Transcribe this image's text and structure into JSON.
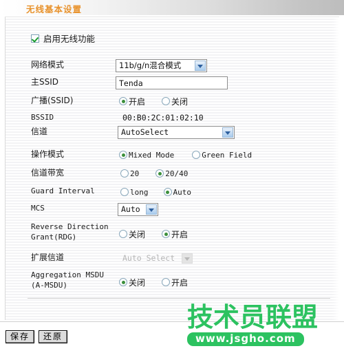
{
  "titlebar": {
    "title": "无线基本设置"
  },
  "enable": {
    "label": "启用无线功能",
    "checked": true
  },
  "rows": [
    {
      "label": "网络模式",
      "type": "select",
      "value": "11b/g/n混合模式"
    },
    {
      "label": "主SSID",
      "type": "text",
      "value": "Tenda"
    },
    {
      "label": "广播(SSID)",
      "type": "radio",
      "options": [
        "开启",
        "关闭"
      ],
      "selected": "开启"
    },
    {
      "label": "BSSID",
      "type": "static",
      "value": "00:B0:2C:01:02:10"
    },
    {
      "label": "信道",
      "type": "select",
      "value": "AutoSelect"
    },
    {
      "label": "操作模式",
      "type": "radio",
      "options": [
        "Mixed Mode",
        "Green Field"
      ],
      "selected": "Mixed Mode"
    },
    {
      "label": "信道带宽",
      "type": "radio",
      "options": [
        "20",
        "20/40"
      ],
      "selected": "20/40"
    },
    {
      "label": "Guard Interval",
      "type": "radio",
      "options": [
        "long",
        "Auto"
      ],
      "selected": "Auto"
    },
    {
      "label": "MCS",
      "type": "select",
      "value": "Auto"
    },
    {
      "label": "Reverse Direction Grant(RDG)",
      "label_line1": "Reverse Direction",
      "label_line2": "Grant(RDG)",
      "type": "radio",
      "options": [
        "关闭",
        "开启"
      ],
      "selected": "开启"
    },
    {
      "label": "扩展信道",
      "type": "select",
      "value": "Auto Select",
      "disabled": true
    },
    {
      "label": "Aggregation MSDU (A-MSDU)",
      "label_line1": "Aggregation MSDU",
      "label_line2": "(A-MSDU)",
      "type": "radio",
      "options": [
        "关闭",
        "开启"
      ],
      "selected": "关闭"
    }
  ],
  "buttons": {
    "save": "保存",
    "restore": "还原"
  },
  "watermark": {
    "main": "技术员联盟",
    "sub": "www.jsgho.com",
    "color": "#2cc260"
  },
  "colors": {
    "title": "#e8922c",
    "radio_dot": "#3b8f3b",
    "check": "#1a9c2f"
  }
}
